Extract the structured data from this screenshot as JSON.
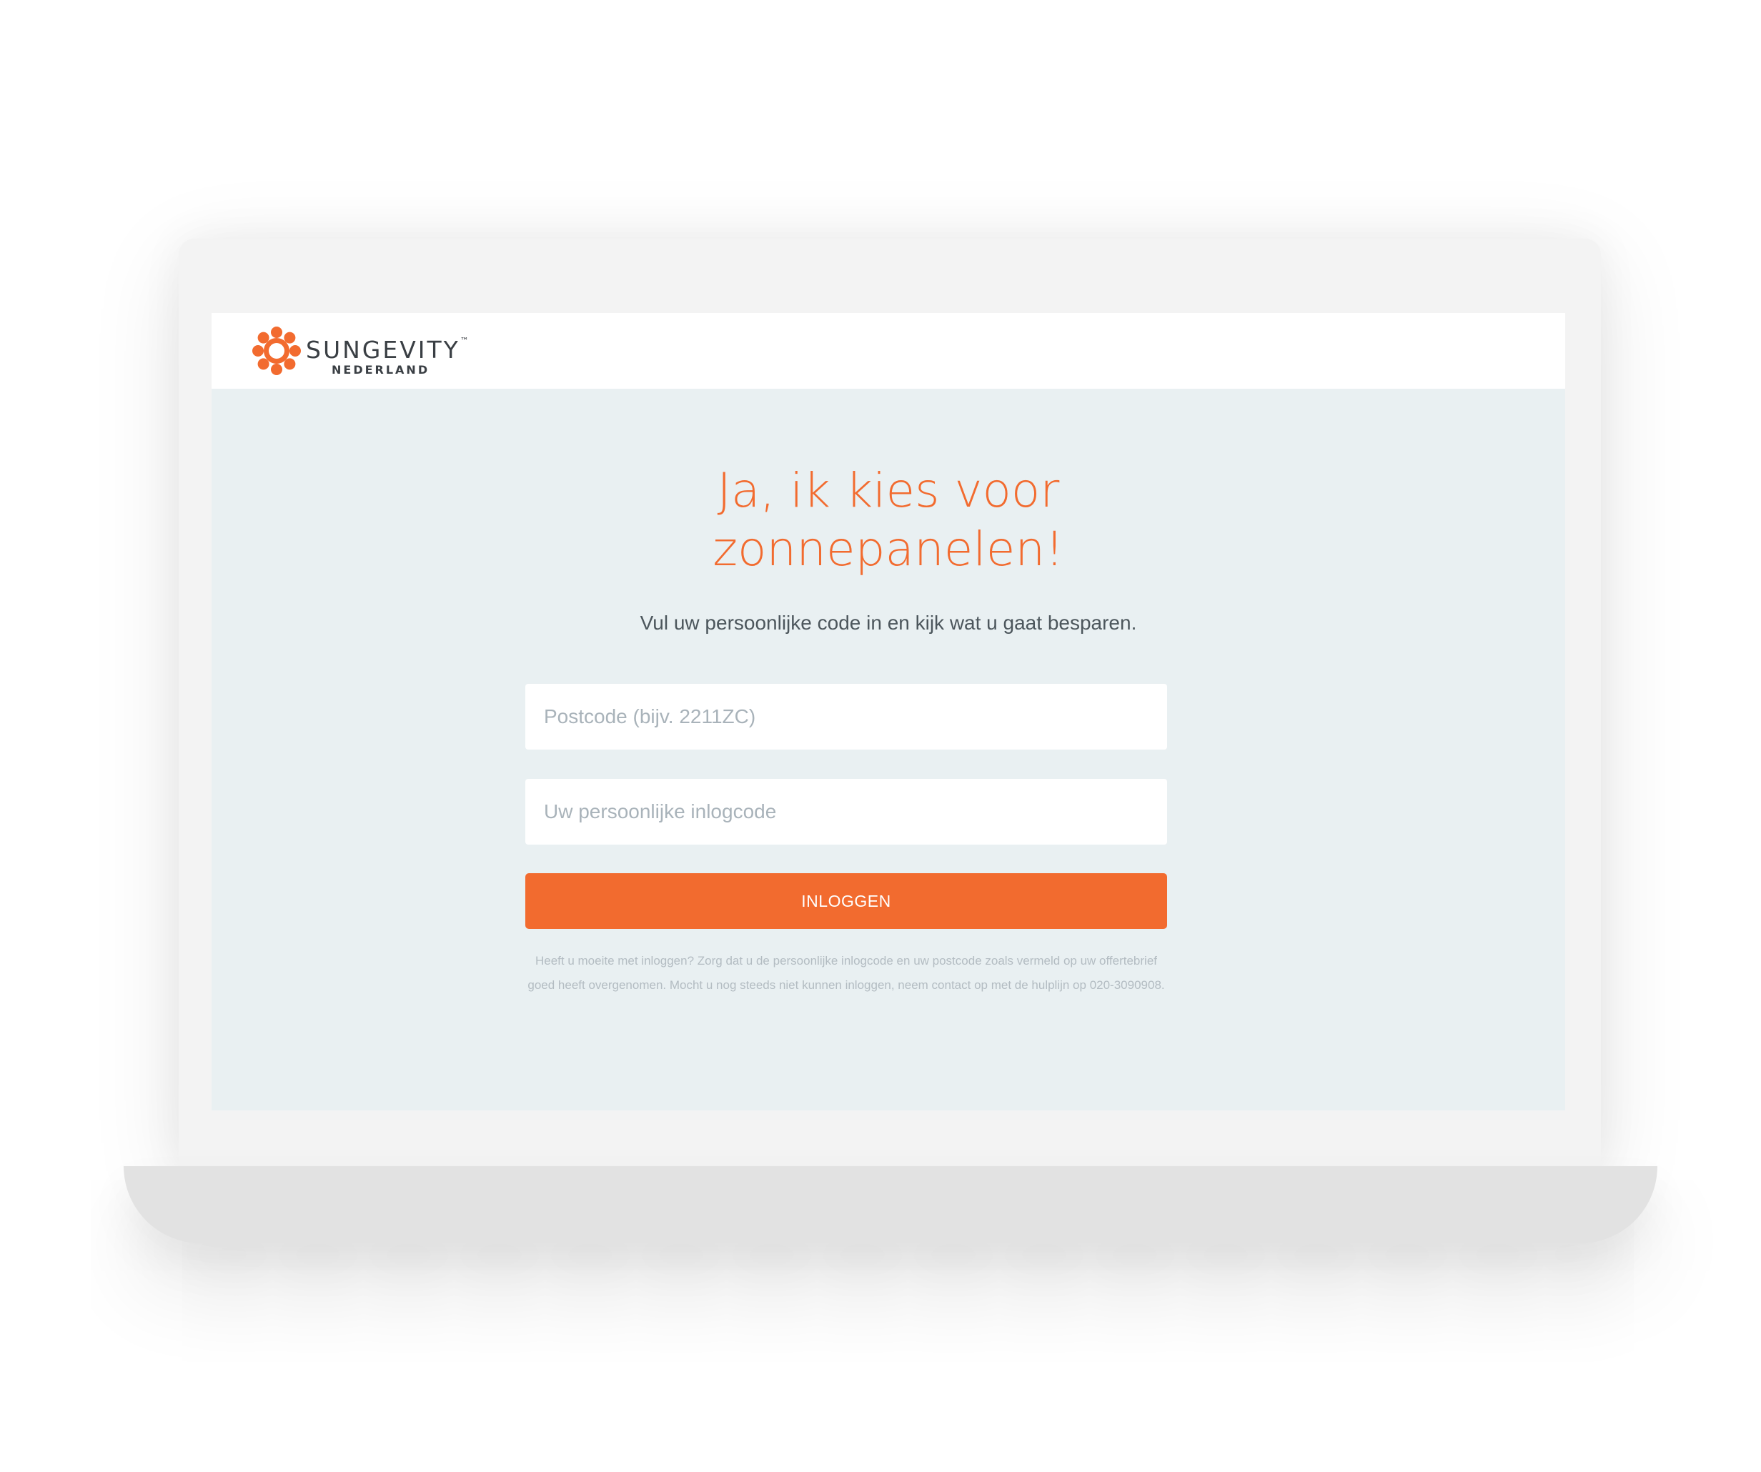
{
  "brand": {
    "name": "SUNGEVITY",
    "trademark": "™",
    "sub": "NEDERLAND",
    "accent_color": "#f26b2f",
    "icon": "sun-flower-logo-icon"
  },
  "main": {
    "title_line1": "Ja, ik kies voor",
    "title_line2": "zonnepanelen!",
    "subtitle": "Vul uw persoonlijke code in en kijk wat u gaat besparen."
  },
  "form": {
    "postcode_placeholder": "Postcode (bijv. 2211ZC)",
    "code_placeholder": "Uw persoonlijke inlogcode",
    "submit_label": "INLOGGEN"
  },
  "help_text": "Heeft u moeite met inloggen? Zorg dat u de persoonlijke inlogcode en uw postcode zoals vermeld op uw offertebrief goed heeft overgenomen. Mocht u nog steeds niet kunnen inloggen, neem contact op met de hulplijn op 020-3090908."
}
